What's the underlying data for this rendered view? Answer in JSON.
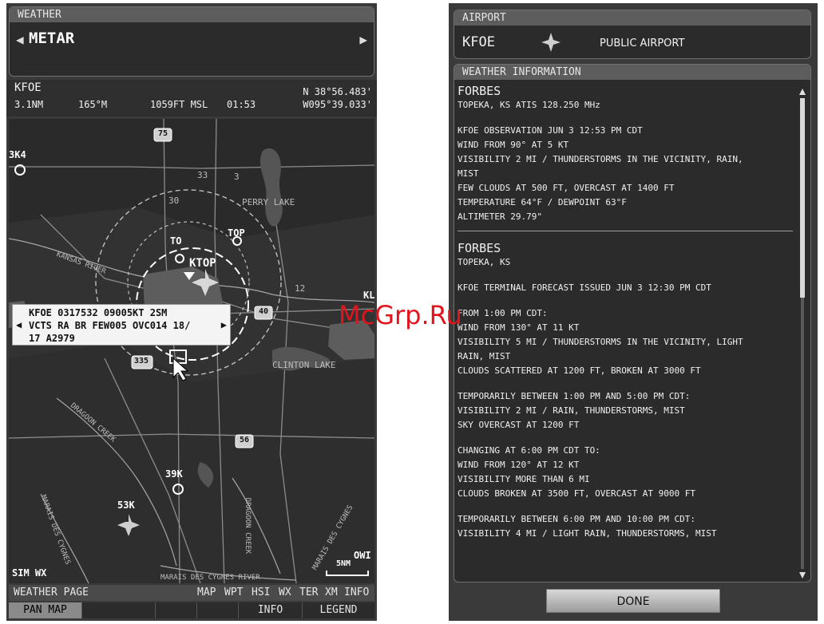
{
  "left": {
    "weather_title": "WEATHER",
    "page_name": "METAR",
    "nav": {
      "waypoint": "KFOE",
      "distance": "3.1NM",
      "bearing": "165°M",
      "altitude": "1059FT MSL",
      "ete": "01:53",
      "lat": "N 38°56.483'",
      "lon": "W095°39.033'"
    },
    "map": {
      "labels": {
        "k3k4": "3K4",
        "perry_lake": "PERRY LAKE",
        "to": "TO",
        "top": "TOP",
        "ktop": "KTOP",
        "kansas_river": "KANSAS RIVER",
        "clinton_lake": "CLINTON LAKE",
        "k39k": "39K",
        "k53k": "53K",
        "dragoon_creek": "DRAGOON CREEK",
        "marais_river": "MARAIS DES CYGNES RIVER",
        "marais_left": "MARAIS DES CYGNES",
        "marais_right": "MARAIS DES CYGNES",
        "dragoon_v": "DRAGOON CREEK",
        "kl": "KL",
        "owi": "OWI",
        "hwy75": "75",
        "hwy40": "40",
        "hwy335": "335",
        "hwy56": "56",
        "ring_33": "33",
        "ring_30": "30",
        "ring_3": "3",
        "ring_12": "12",
        "scale": "5NM",
        "sim_wx": "SIM WX"
      },
      "metar_popup": {
        "line1": "KFOE 0317532 09005KT 2SM",
        "line2": "VCTS RA BR FEW005 OVC014 18/",
        "line3": "17 A2979"
      }
    },
    "softkeys": {
      "page_label": "WEATHER PAGE",
      "top_keys": [
        "MAP",
        "WPT",
        "HSI",
        "WX",
        "TER",
        "XM",
        "INFO"
      ],
      "bottom_keys": [
        "PAN MAP",
        "",
        "",
        "",
        "INFO",
        "LEGEND"
      ]
    }
  },
  "right": {
    "airport_title": "AIRPORT",
    "airport_id": "KFOE",
    "airport_type": "PUBLIC AIRPORT",
    "weather_info_title": "WEATHER INFORMATION",
    "metar_block": {
      "name": "FORBES",
      "location": "TOPEKA, KS    ATIS 128.250 MHz",
      "lines": [
        "KFOE OBSERVATION JUN 3 12:53 PM CDT",
        "WIND FROM 90° AT 5 KT",
        "VISIBILITY 2 MI / THUNDERSTORMS IN THE VICINITY, RAIN,",
        "MIST",
        "FEW CLOUDS AT 500 FT, OVERCAST AT 1400 FT",
        "TEMPERATURE 64°F / DEWPOINT 63°F",
        "ALTIMETER 29.79\""
      ]
    },
    "taf_block": {
      "name": "FORBES",
      "location": "TOPEKA, KS",
      "issued": "KFOE TERMINAL FORECAST ISSUED JUN 3 12:30 PM CDT",
      "groups": [
        [
          "FROM 1:00 PM CDT:",
          "WIND FROM 130° AT 11 KT",
          "VISIBILITY 5 MI / THUNDERSTORMS IN THE VICINITY, LIGHT",
          "RAIN, MIST",
          "CLOUDS SCATTERED AT 1200 FT, BROKEN AT 3000 FT"
        ],
        [
          "TEMPORARILY BETWEEN 1:00 PM AND 5:00 PM CDT:",
          "VISIBILITY 2 MI / RAIN, THUNDERSTORMS, MIST",
          "SKY OVERCAST AT 1200 FT"
        ],
        [
          "CHANGING AT 6:00 PM CDT TO:",
          "WIND FROM 120° AT 12 KT",
          "VISIBILITY MORE THAN 6 MI",
          "CLOUDS BROKEN AT 3500 FT, OVERCAST AT 9000 FT"
        ],
        [
          "TEMPORARILY BETWEEN 6:00 PM AND 10:00 PM CDT:",
          "VISIBILITY 4 MI / LIGHT RAIN, THUNDERSTORMS, MIST"
        ]
      ]
    },
    "done_label": "DONE"
  },
  "watermark": "McGrp.Ru"
}
